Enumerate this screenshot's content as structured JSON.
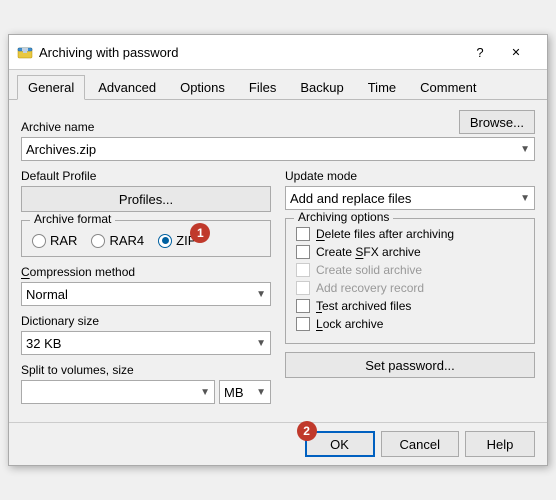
{
  "window": {
    "title": "Archiving with password",
    "help_label": "?",
    "close_label": "✕"
  },
  "tabs": [
    {
      "label": "General",
      "underline": "G",
      "active": true
    },
    {
      "label": "Advanced",
      "underline": "A",
      "active": false
    },
    {
      "label": "Options",
      "underline": "O",
      "active": false
    },
    {
      "label": "Files",
      "underline": "F",
      "active": false
    },
    {
      "label": "Backup",
      "underline": "B",
      "active": false
    },
    {
      "label": "Time",
      "underline": "T",
      "active": false
    },
    {
      "label": "Comment",
      "underline": "C",
      "active": false
    }
  ],
  "archive_name": {
    "label": "Archive name",
    "value": "Archives.zip",
    "browse_label": "Browse..."
  },
  "default_profile": {
    "label": "Default Profile",
    "profiles_label": "Profiles..."
  },
  "update_mode": {
    "label": "Update mode",
    "value": "Add and replace files"
  },
  "archive_format": {
    "label": "Archive format",
    "options": [
      "RAR",
      "RAR4",
      "ZIP"
    ],
    "selected": "ZIP"
  },
  "compression_method": {
    "label": "Compression method",
    "value": "Normal"
  },
  "dictionary_size": {
    "label": "Dictionary size",
    "value": "32 KB"
  },
  "split_volumes": {
    "label": "Split to volumes, size",
    "value": "",
    "unit": "MB"
  },
  "archiving_options": {
    "label": "Archiving options",
    "options": [
      {
        "label": "Delete files after archiving",
        "checked": false,
        "disabled": false,
        "underline": "D"
      },
      {
        "label": "Create SFX archive",
        "checked": false,
        "disabled": false,
        "underline": "S"
      },
      {
        "label": "Create solid archive",
        "checked": false,
        "disabled": true,
        "underline": ""
      },
      {
        "label": "Add recovery record",
        "checked": false,
        "disabled": true,
        "underline": ""
      },
      {
        "label": "Test archived files",
        "checked": false,
        "disabled": false,
        "underline": "T"
      },
      {
        "label": "Lock archive",
        "checked": false,
        "disabled": false,
        "underline": "L"
      }
    ]
  },
  "set_password_label": "Set password...",
  "buttons": {
    "ok_label": "OK",
    "cancel_label": "Cancel",
    "help_label": "Help"
  },
  "badges": [
    {
      "number": "1",
      "position": "zip-radio"
    },
    {
      "number": "2",
      "position": "ok-button"
    }
  ]
}
